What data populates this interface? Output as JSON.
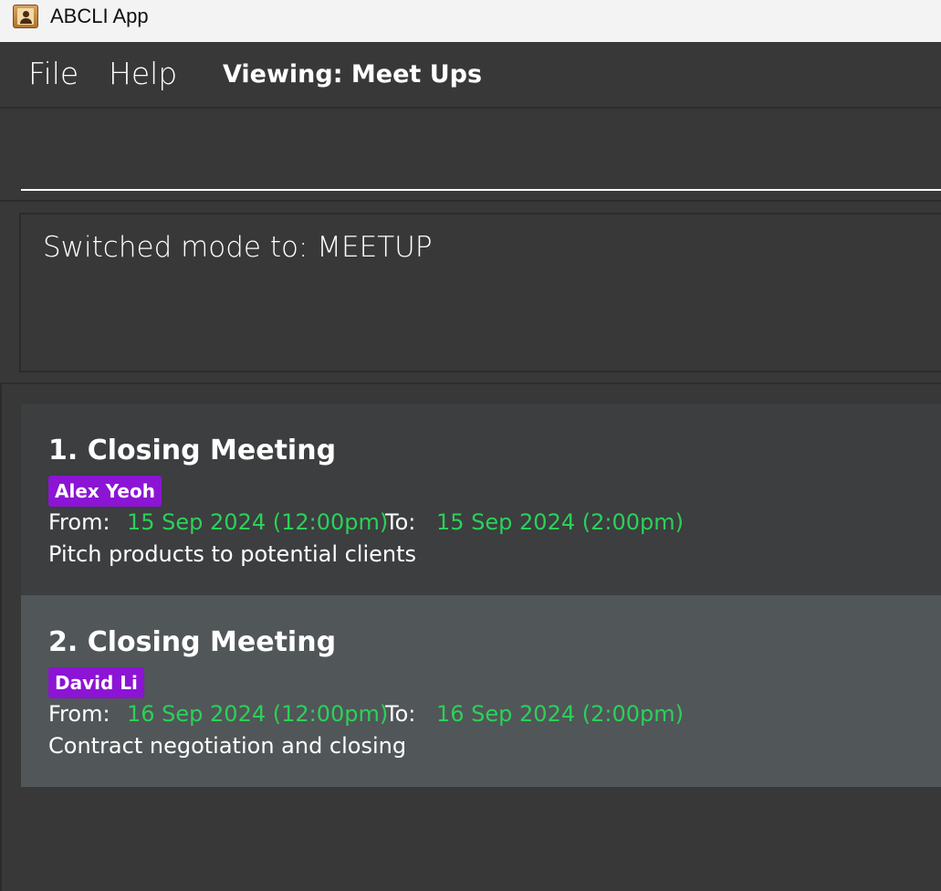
{
  "window": {
    "title": "ABCLI App",
    "icon": "address-book-icon"
  },
  "menu": {
    "file": "File",
    "help": "Help",
    "viewing": "Viewing: Meet Ups"
  },
  "command": {
    "value": "",
    "placeholder": ""
  },
  "result": {
    "message": "Switched mode to: MEETUP"
  },
  "meetups": [
    {
      "title": "1. Closing Meeting",
      "tag": "Alex Yeoh",
      "from_label": "From:",
      "from": "15 Sep 2024 (12:00pm)",
      "to_label": "To:",
      "to": "15 Sep 2024 (2:00pm)",
      "description": "Pitch products to potential clients"
    },
    {
      "title": "2. Closing Meeting",
      "tag": "David Li",
      "from_label": "From:",
      "from": "16 Sep 2024 (12:00pm)",
      "to_label": "To:",
      "to": "16 Sep 2024 (2:00pm)",
      "description": "Contract negotiation and closing"
    }
  ],
  "colors": {
    "background": "#383838",
    "card_odd": "#3c3e3f",
    "card_even": "#515658",
    "tag": "#8c14d4",
    "datetime": "#2bd159"
  }
}
